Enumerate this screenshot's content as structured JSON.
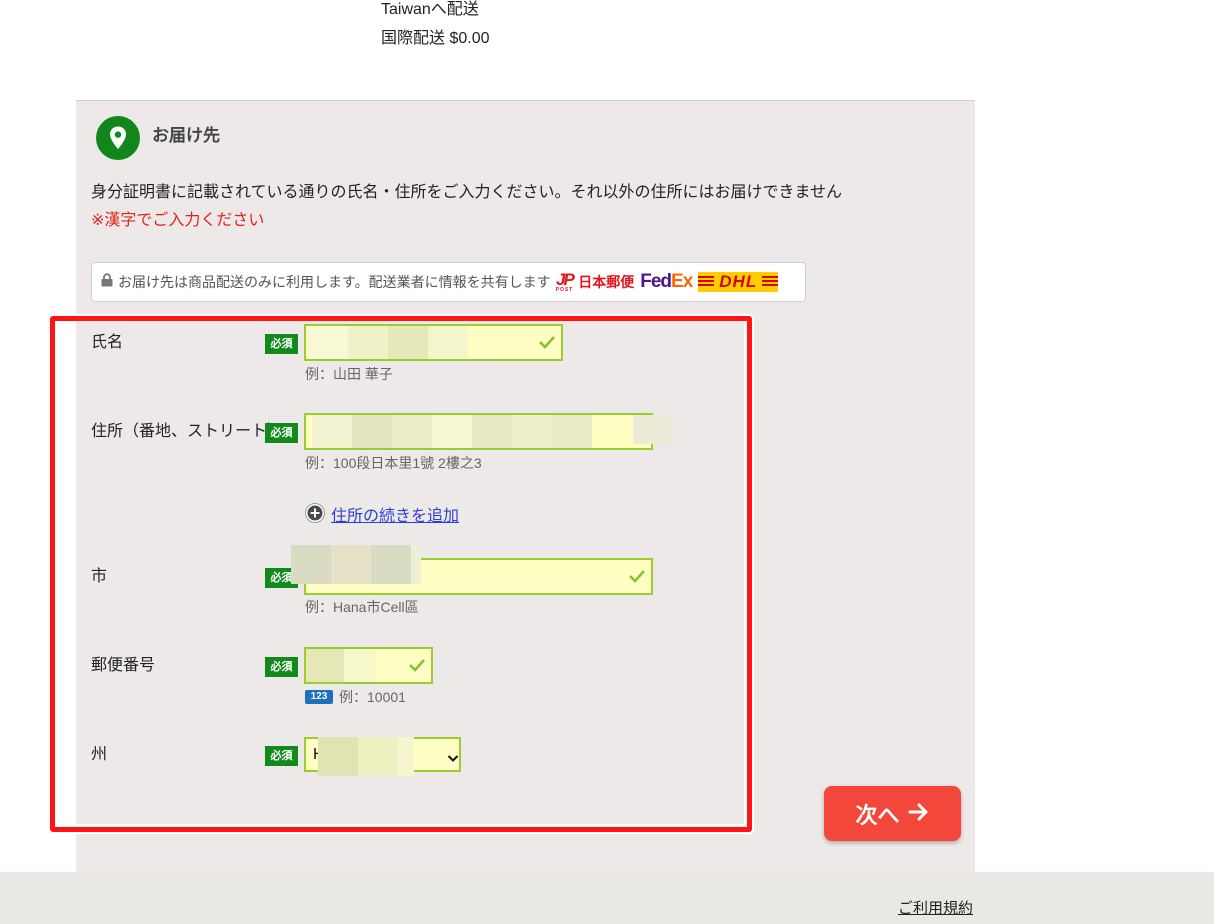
{
  "shipping": {
    "destination": "Taiwanへ配送",
    "fee": "国際配送 $0.00"
  },
  "delivery": {
    "title": "お届け先",
    "notice": "身分証明書に記載されている通りの氏名・住所をご入力ください。それ以外の住所にはお届けできません",
    "kanji_note": "※漢字でご入力ください",
    "privacy_text": "お届け先は商品配送のみに利用します。配送業者に情報を共有します",
    "carriers": {
      "jp_post_mark": "JP",
      "jp_post_sub": "POST",
      "jp_post_name": "日本郵便",
      "fedex_fed": "Fed",
      "fedex_ex": "Ex",
      "dhl": "DHL"
    }
  },
  "form": {
    "required": "必須",
    "name": {
      "label": "氏名",
      "hint": "例：山田 華子"
    },
    "address": {
      "label": "住所（番地、ストリート）",
      "hint": "例：100段日本里1號 2樓之3"
    },
    "add_address_line": "住所の続きを追加",
    "city": {
      "label": "市",
      "hint": "例：Hana市Cell區"
    },
    "postal": {
      "label": "郵便番号",
      "numeric_badge": "123",
      "hint": "例：10001"
    },
    "state": {
      "label": "州",
      "selected": "H"
    }
  },
  "actions": {
    "next": "次へ"
  },
  "footer": {
    "terms": "ご利用規約"
  },
  "colors": {
    "panel_bg": "#eee9e9",
    "required_badge": "#118a1b",
    "input_valid_border": "#9acd32",
    "input_valid_bg": "#ffffc4",
    "warning_text": "#e3231b",
    "link": "#2b3fd6",
    "next_button": "#f2473a",
    "annotation_box": "#ff1414"
  },
  "icons": [
    "location-pin-icon",
    "lock-icon",
    "check-icon",
    "plus-circle-icon",
    "chevron-down-icon",
    "arrow-right-icon"
  ]
}
